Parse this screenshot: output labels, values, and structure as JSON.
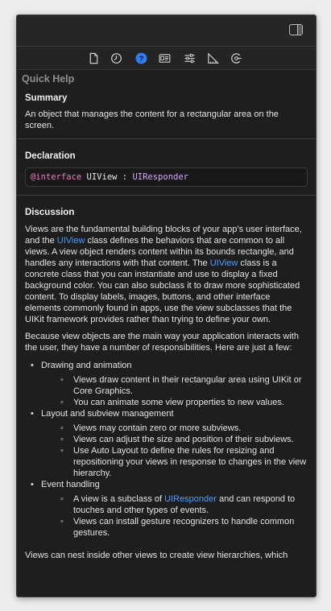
{
  "toolbar": {
    "tabs": [
      {
        "icon": "file-icon",
        "active": false
      },
      {
        "icon": "history-icon",
        "active": false
      },
      {
        "icon": "quick-help-icon",
        "active": true
      },
      {
        "icon": "identity-icon",
        "active": false
      },
      {
        "icon": "attributes-icon",
        "active": false
      },
      {
        "icon": "size-icon",
        "active": false
      },
      {
        "icon": "connections-icon",
        "active": false
      }
    ],
    "panel_toggle_icon": "sidebar-right-icon"
  },
  "quick_help": {
    "header": "Quick Help",
    "summary": {
      "title": "Summary",
      "text": "An object that manages the content for a rectangular area on the screen."
    },
    "declaration": {
      "title": "Declaration",
      "keyword": "@interface",
      "name": " UIView : ",
      "superclass": "UIResponder"
    },
    "discussion": {
      "title": "Discussion",
      "p1": {
        "a": "Views are the fundamental building blocks of your app’s user interface, and the ",
        "link1": "UIView",
        "b": " class defines the behaviors that are common to all views. A view object renders content within its bounds rectangle, and handles any interactions with that content. The ",
        "link2": "UIView",
        "c": " class is a concrete class that you can instantiate and use to display a fixed background color. You can also subclass it to draw more sophisticated content. To display labels, images, buttons, and other interface elements commonly found in apps, use the view subclasses that the UIKit framework provides rather than trying to define your own."
      },
      "p2": "Because view objects are the main way your application interacts with the user, they have a number of responsibilities. Here are just a few:",
      "list": {
        "drawing": {
          "label": "Drawing and animation",
          "items": [
            "Views draw content in their rectangular area using UIKit or Core Graphics.",
            "You can animate some view properties to new values."
          ]
        },
        "layout": {
          "label": "Layout and subview management",
          "items": [
            "Views may contain zero or more subviews.",
            "Views can adjust the size and position of their subviews.",
            "Use Auto Layout to define the rules for resizing and repositioning your views in response to changes in the view hierarchy."
          ]
        },
        "events": {
          "label": "Event handling",
          "item1": {
            "a": "A view is a subclass of ",
            "link": "UIResponder",
            "b": " and can respond to touches and other types of events."
          },
          "item2": "Views can install gesture recognizers to handle common gestures."
        }
      },
      "p3": "Views can nest inside other views to create view hierarchies, which"
    }
  }
}
